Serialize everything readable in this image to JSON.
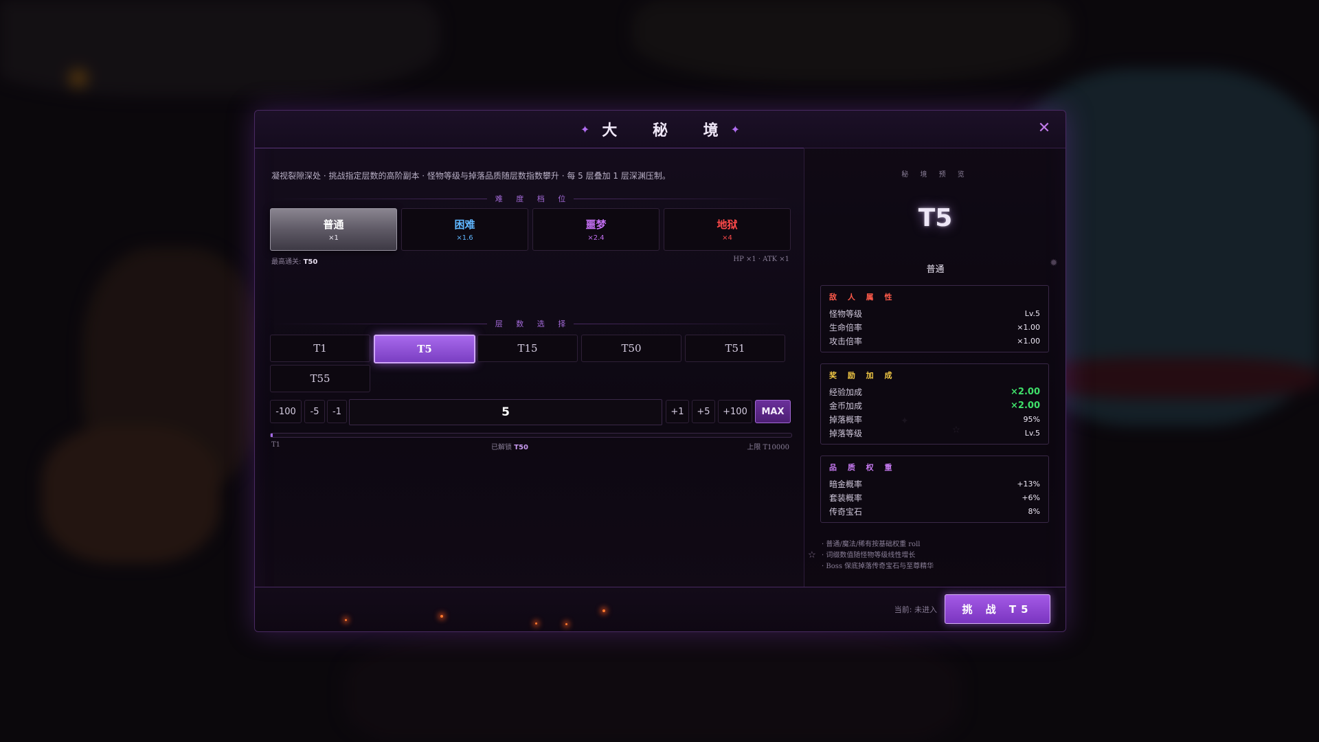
{
  "modal": {
    "title": "大 秘 境",
    "close_glyph": "✕",
    "sparkle_glyph": "✦"
  },
  "description": "凝视裂隙深处 · 挑战指定层数的高阶副本 · 怪物等级与掉落品质随层数指数攀升 · 每 5 层叠加 1 层深渊压制。",
  "difficulty": {
    "section_title": "难 度 档 位",
    "options": [
      {
        "name": "普通",
        "multiplier": "×1",
        "color": "#ffffff",
        "active": true
      },
      {
        "name": "困难",
        "multiplier": "×1.6",
        "color": "#5fb6ff",
        "active": false
      },
      {
        "name": "噩梦",
        "multiplier": "×2.4",
        "color": "#c36ff2",
        "active": false
      },
      {
        "name": "地狱",
        "multiplier": "×4",
        "color": "#ff4a4a",
        "active": false
      }
    ],
    "best_clear_label": "最高通关:",
    "best_clear_value": "T50",
    "scaling_text": "HP ×1 · ATK ×1"
  },
  "floors": {
    "section_title": "层 数 选 择",
    "options": [
      "T1",
      "T5",
      "T15",
      "T50",
      "T51",
      "T55"
    ],
    "selected": "T5"
  },
  "stepper": {
    "dec_buttons": [
      "-100",
      "-5",
      "-1"
    ],
    "inc_buttons": [
      "+1",
      "+5",
      "+100"
    ],
    "max_label": "MAX",
    "value": "5"
  },
  "progress": {
    "fraction": 0.0005,
    "min_label": "T1",
    "unlocked_label": "已解锁",
    "unlocked_value": "T50",
    "max_label": "上限 T10000"
  },
  "preview": {
    "label": "秘 境 预 览",
    "floor": "T5",
    "difficulty": "普通",
    "enemy": {
      "title": "敌 人 属 性",
      "title_color": "#ff5a4a",
      "rows": [
        {
          "k": "怪物等级",
          "v": "Lv.5"
        },
        {
          "k": "生命倍率",
          "v": "×1.00"
        },
        {
          "k": "攻击倍率",
          "v": "×1.00"
        }
      ]
    },
    "reward": {
      "title": "奖 励 加 成",
      "title_color": "#f2c945",
      "rows": [
        {
          "k": "经验加成",
          "v": "×2.00"
        },
        {
          "k": "金币加成",
          "v": "×2.00"
        },
        {
          "k": "掉落概率",
          "v": "95%"
        },
        {
          "k": "掉落等级",
          "v": "Lv.5"
        }
      ]
    },
    "quality": {
      "title": "品 质 权 重",
      "title_color": "#c77af2",
      "rows": [
        {
          "k": "暗金概率",
          "v": "+13%"
        },
        {
          "k": "套装概率",
          "v": "+6%"
        },
        {
          "k": "传奇宝石",
          "v": "8%"
        }
      ]
    },
    "notes": [
      "· 普通/魔法/稀有按基础权重 roll",
      "· 词缀数值随怪物等级线性增长",
      "· Boss 保底掉落传奇宝石与至尊精华"
    ]
  },
  "footer": {
    "status": "当前: 未进入",
    "challenge_label": "挑 战 T5"
  }
}
